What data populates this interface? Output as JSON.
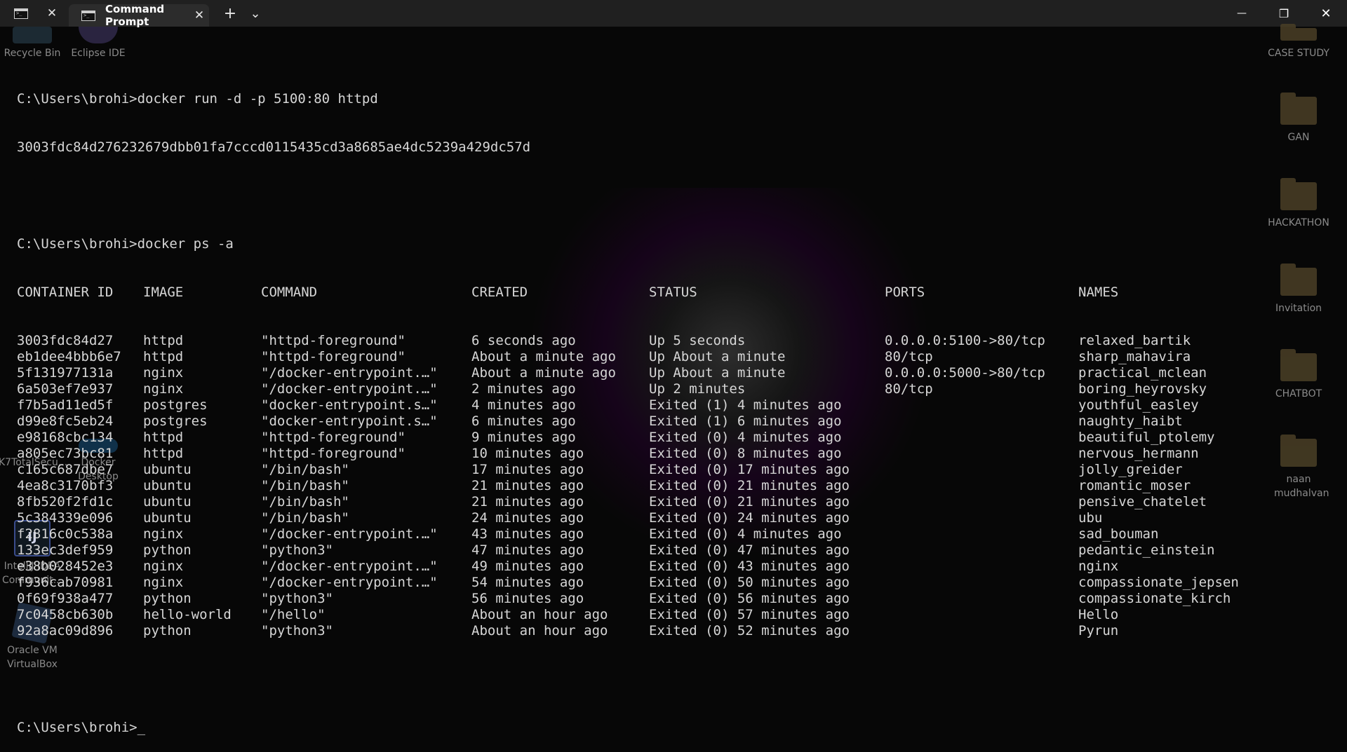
{
  "titlebar": {
    "inactive_tab_close": "✕",
    "active_tab_title": "Command Prompt",
    "active_tab_close": "✕",
    "new_tab": "+",
    "dropdown": "⌄",
    "minimize": "—",
    "maximize": "❐",
    "close": "✕"
  },
  "desktop": {
    "left_icons": [
      {
        "label": "Recycle Bin"
      },
      {
        "label": "Eclipse IDE"
      },
      {
        "label": "K7TotalSecu..."
      },
      {
        "label": "Docker Desktop"
      },
      {
        "label": "IntelliJ IDEA Communit..."
      },
      {
        "label": "Oracle VM VirtualBox"
      }
    ],
    "right_folders": [
      {
        "label": "CASE STUDY"
      },
      {
        "label": "GAN"
      },
      {
        "label": "HACKATHON"
      },
      {
        "label": "Invitation"
      },
      {
        "label": "CHATBOT"
      },
      {
        "label": "naan mudhalvan"
      }
    ]
  },
  "terminal": {
    "cmd1": "C:\\Users\\brohi>docker run -d -p 5100:80 httpd",
    "cmd1_output": "3003fdc84d276232679dbb01fa7cccd0115435cd3a8685ae4dc5239a429dc57d",
    "cmd2": "C:\\Users\\brohi>docker ps -a",
    "headers": [
      "CONTAINER ID",
      "IMAGE",
      "COMMAND",
      "CREATED",
      "STATUS",
      "PORTS",
      "NAMES"
    ],
    "rows": [
      [
        "3003fdc84d27",
        "httpd",
        "\"httpd-foreground\"",
        "6 seconds ago",
        "Up 5 seconds",
        "0.0.0.0:5100->80/tcp",
        "relaxed_bartik"
      ],
      [
        "eb1dee4bbb6e7",
        "httpd",
        "\"httpd-foreground\"",
        "About a minute ago",
        "Up About a minute",
        "80/tcp",
        "sharp_mahavira"
      ],
      [
        "5f131977131a",
        "nginx",
        "\"/docker-entrypoint.…\"",
        "About a minute ago",
        "Up About a minute",
        "0.0.0.0:5000->80/tcp",
        "practical_mclean"
      ],
      [
        "6a503ef7e937",
        "nginx",
        "\"/docker-entrypoint.…\"",
        "2 minutes ago",
        "Up 2 minutes",
        "80/tcp",
        "boring_heyrovsky"
      ],
      [
        "f7b5ad11ed5f",
        "postgres",
        "\"docker-entrypoint.s…\"",
        "4 minutes ago",
        "Exited (1) 4 minutes ago",
        "",
        "youthful_easley"
      ],
      [
        "d99e8fc5eb24",
        "postgres",
        "\"docker-entrypoint.s…\"",
        "6 minutes ago",
        "Exited (1) 6 minutes ago",
        "",
        "naughty_haibt"
      ],
      [
        "e98168cbc134",
        "httpd",
        "\"httpd-foreground\"",
        "9 minutes ago",
        "Exited (0) 4 minutes ago",
        "",
        "beautiful_ptolemy"
      ],
      [
        "a805ec73bc81",
        "httpd",
        "\"httpd-foreground\"",
        "10 minutes ago",
        "Exited (0) 8 minutes ago",
        "",
        "nervous_hermann"
      ],
      [
        "c165c687dbe7",
        "ubuntu",
        "\"/bin/bash\"",
        "17 minutes ago",
        "Exited (0) 17 minutes ago",
        "",
        "jolly_greider"
      ],
      [
        "4ea8c3170bf3",
        "ubuntu",
        "\"/bin/bash\"",
        "21 minutes ago",
        "Exited (0) 21 minutes ago",
        "",
        "romantic_moser"
      ],
      [
        "8fb520f2fd1c",
        "ubuntu",
        "\"/bin/bash\"",
        "21 minutes ago",
        "Exited (0) 21 minutes ago",
        "",
        "pensive_chatelet"
      ],
      [
        "5c384339e096",
        "ubuntu",
        "\"/bin/bash\"",
        "24 minutes ago",
        "Exited (0) 24 minutes ago",
        "",
        "ubu"
      ],
      [
        "f2816c0c538a",
        "nginx",
        "\"/docker-entrypoint.…\"",
        "43 minutes ago",
        "Exited (0) 4 minutes ago",
        "",
        "sad_bouman"
      ],
      [
        "133ec3def959",
        "python",
        "\"python3\"",
        "47 minutes ago",
        "Exited (0) 47 minutes ago",
        "",
        "pedantic_einstein"
      ],
      [
        "e38b028452e3",
        "nginx",
        "\"/docker-entrypoint.…\"",
        "49 minutes ago",
        "Exited (0) 43 minutes ago",
        "",
        "nginx"
      ],
      [
        "f936cab70981",
        "nginx",
        "\"/docker-entrypoint.…\"",
        "54 minutes ago",
        "Exited (0) 50 minutes ago",
        "",
        "compassionate_jepsen"
      ],
      [
        "0f69f938a477",
        "python",
        "\"python3\"",
        "56 minutes ago",
        "Exited (0) 56 minutes ago",
        "",
        "compassionate_kirch"
      ],
      [
        "7c0458cb630b",
        "hello-world",
        "\"/hello\"",
        "About an hour ago",
        "Exited (0) 57 minutes ago",
        "",
        "Hello"
      ],
      [
        "92a8ac09d896",
        "python",
        "\"python3\"",
        "About an hour ago",
        "Exited (0) 52 minutes ago",
        "",
        "Pyrun"
      ]
    ],
    "prompt": "C:\\Users\\brohi>",
    "cursor": "_"
  }
}
